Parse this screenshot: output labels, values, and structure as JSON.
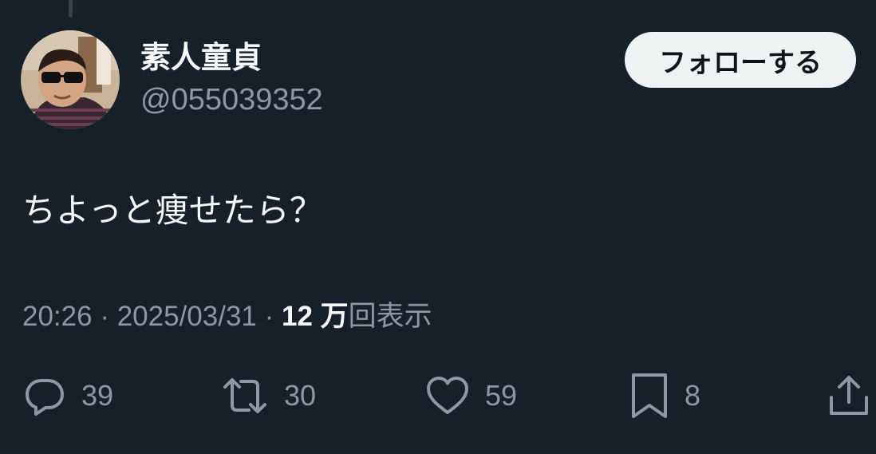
{
  "user": {
    "display_name": "素人童貞",
    "handle": "@055039352"
  },
  "follow_button": {
    "label": "フォローする"
  },
  "tweet": {
    "text": "ちよっと痩せたら？"
  },
  "meta": {
    "time": "20:26",
    "separator": "·",
    "date": "2025/03/31",
    "views_count": "12 万",
    "views_label": "回表示"
  },
  "actions": {
    "reply": {
      "icon": "reply-icon",
      "count": "39"
    },
    "retweet": {
      "icon": "retweet-icon",
      "count": "30"
    },
    "like": {
      "icon": "heart-icon",
      "count": "59"
    },
    "bookmark": {
      "icon": "bookmark-icon",
      "count": "8"
    },
    "share": {
      "icon": "share-icon"
    }
  },
  "colors": {
    "background": "#15202b",
    "primary_text": "#f7f9f9",
    "secondary_text": "#8b98a5",
    "follow_button_bg": "#eff3f4",
    "follow_button_text": "#0f1419"
  }
}
